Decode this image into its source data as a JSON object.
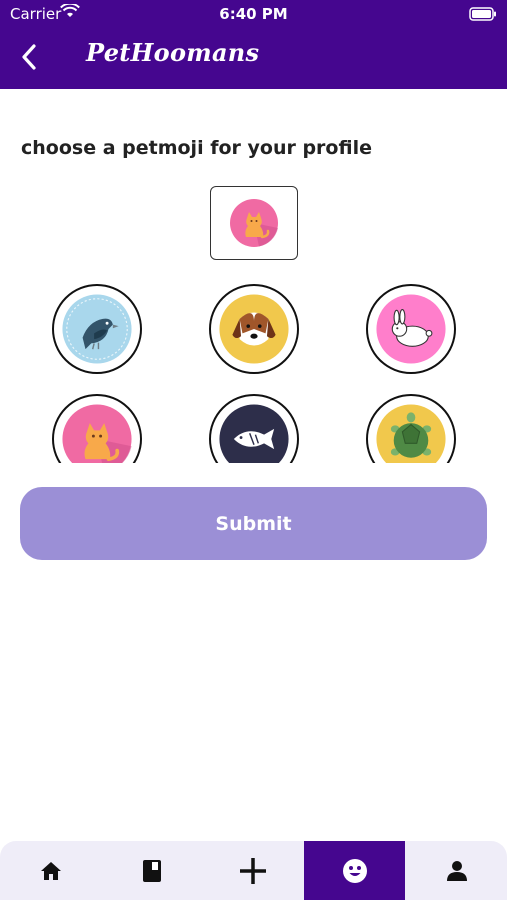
{
  "status_bar": {
    "carrier": "Carrier",
    "time": "6:40 PM"
  },
  "nav": {
    "title": "PetHoomans",
    "back_icon": "chevron-left-icon"
  },
  "prompt": "choose a petmoji for your profile",
  "selected_petmoji": "cat",
  "petmojis": [
    "bird",
    "dog",
    "rabbit",
    "cat",
    "fish",
    "turtle"
  ],
  "submit_label": "Submit",
  "tabs": [
    {
      "icon": "home-icon"
    },
    {
      "icon": "book-icon"
    },
    {
      "icon": "plus-icon"
    },
    {
      "icon": "smiley-icon",
      "active": true
    },
    {
      "icon": "person-icon"
    }
  ],
  "colors": {
    "brand": "#45068f",
    "submit_bg": "#9b8fd6",
    "tabbar_bg": "#efedf8"
  }
}
